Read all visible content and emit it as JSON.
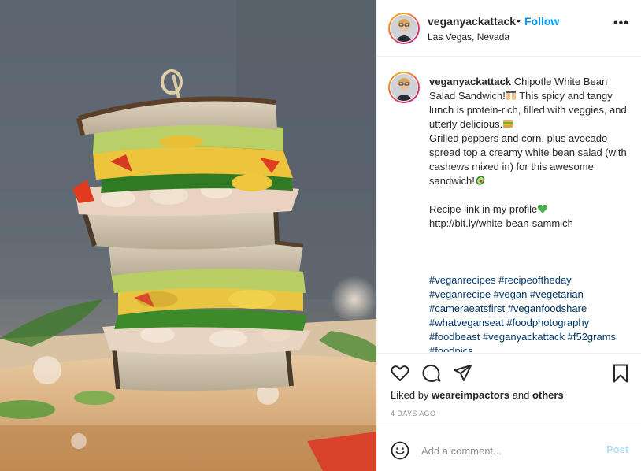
{
  "post": {
    "image_alt": "Stacked Chipotle White Bean Salad Sandwich on a wooden board"
  },
  "header": {
    "username": "veganyackattack",
    "separator": "•",
    "follow_label": "Follow",
    "location": "Las Vegas, Nevada",
    "more_icon": "more-horizontal-icon",
    "more_label": "•••"
  },
  "caption": {
    "username": "veganyackattack",
    "text_1": " Chipotle White Bean Salad Sandwich!",
    "text_2": " This spicy and tangy lunch is protein-rich, filled with veggies, and utterly delicious.",
    "text_3": "\nGrilled peppers and corn, plus avocado spread top a creamy white bean salad (with cashews mixed in) for this awesome sandwich!",
    "text_4": "\n\nRecipe link in my profile",
    "text_5": "\nhttp://bit.ly/white-bean-sammich\n\n\n\n",
    "hashtags": "#veganrecipes #recipeoftheday #veganrecipe #vegan #vegetarian #cameraeatsfirst #veganfoodshare #whatveganseat #foodphotography #foodbeast #veganyackattack #f52grams #foodpics",
    "emoji_1": "raising-hands-emoji",
    "emoji_2": "sandwich-emoji",
    "emoji_3": "avocado-emoji",
    "emoji_4": "green-heart-emoji"
  },
  "actions": {
    "like_icon": "heart-icon",
    "comment_icon": "comment-icon",
    "share_icon": "paper-plane-icon",
    "save_icon": "bookmark-icon"
  },
  "likes": {
    "prefix": "Liked by ",
    "user": "weareimpactors",
    "middle": " and ",
    "others": "others"
  },
  "timestamp": "4 DAYS AGO",
  "comment_box": {
    "emoji_icon": "smiley-icon",
    "placeholder": "Add a comment...",
    "post_label": "Post"
  },
  "colors": {
    "follow_blue": "#0095f6",
    "hashtag_blue": "#00376b",
    "post_disabled": "#b2dffc",
    "secondary_text": "#8e8e8e",
    "border": "#efefef"
  }
}
